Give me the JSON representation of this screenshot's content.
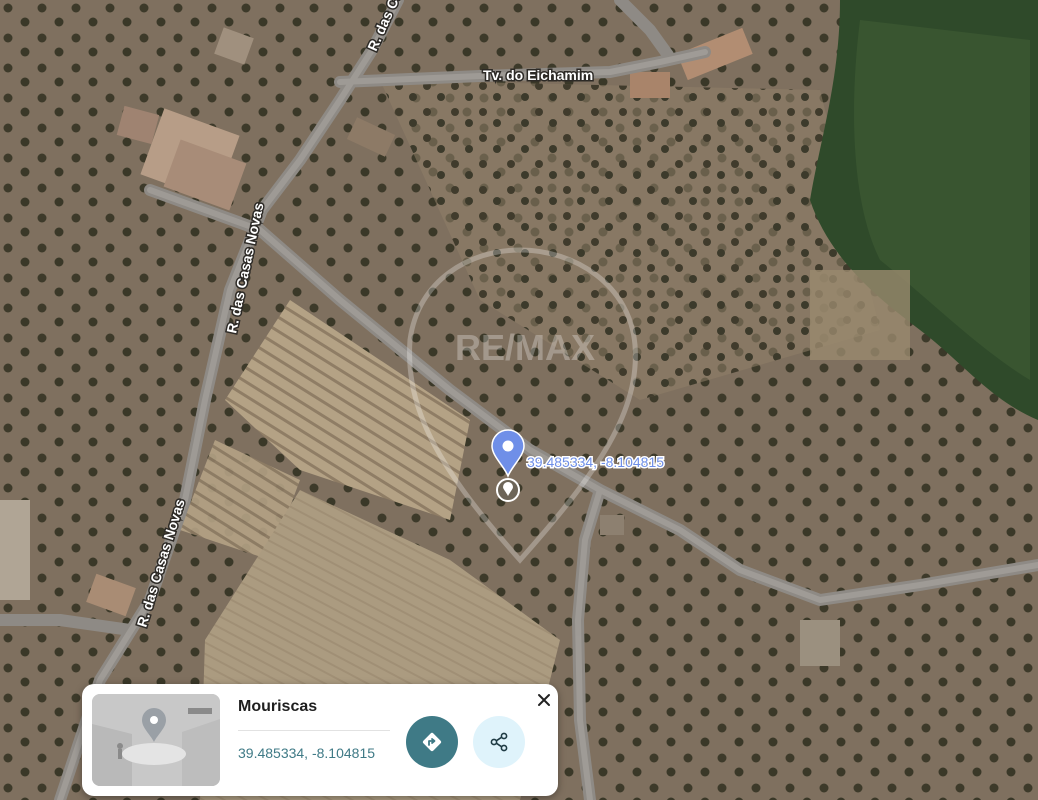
{
  "map": {
    "road_labels": [
      "R. das Casas",
      "Tv. do Eichamim",
      "R. das Casas Novas",
      "R. das Casas Novas"
    ],
    "pin_label": "39.485334, -8.104815",
    "pin_color": "#6f8fe8",
    "watermark_text": "RE/MAX",
    "icons": [
      "location-pin-icon",
      "location-circle-icon"
    ]
  },
  "card": {
    "title": "Mouriscas",
    "coordinates": "39.485334, -8.104815",
    "accent": "#3f7a86",
    "icons": [
      "close-icon",
      "directions-icon",
      "share-icon"
    ]
  }
}
